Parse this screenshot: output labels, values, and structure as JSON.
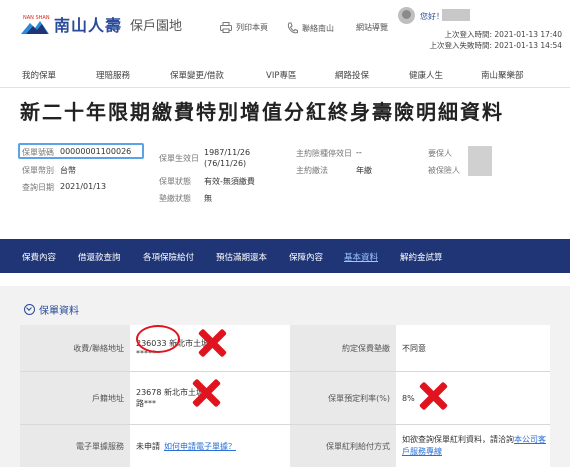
{
  "header": {
    "brand_name": "南山人壽",
    "portal_name": "保戶園地",
    "print_label": "列印本頁",
    "contact_label": "聯絡南山",
    "sitemap_label": "網站導覽",
    "greeting": "您好！",
    "last_login": "上次登入時間: 2021-01-13 17:40",
    "last_failed_login": "上次登入失敗時間: 2021-01-13 14:54"
  },
  "main_nav": [
    "我的保單",
    "理賠服務",
    "保單變更/借款",
    "VIP專區",
    "網路投保",
    "健康人生",
    "南山聚樂部"
  ],
  "page_title": "新二十年限期繳費特別增值分紅終身壽險明細資料",
  "summary": {
    "policy_no_label": "保單號碼",
    "policy_no": "00000001100026",
    "policy_type_label": "保單幣別",
    "policy_type": "台幣",
    "query_date_label": "查詢日期",
    "query_date": "2021/01/13",
    "effective_date_label": "保單生效日",
    "effective_date": "1987/11/26",
    "effective_date_alt": "(76/11/26)",
    "status_label": "保單狀態",
    "status": "有效-無須繳費",
    "loan_label": "墊繳狀態",
    "loan": "無",
    "rider_stop_label": "主約險種停效日",
    "rider_stop": "--",
    "pay_method_label": "主約繳法",
    "pay_method": "年繳",
    "insured_label": "要保人",
    "beneficiary_label": "被保險人"
  },
  "sub_nav": [
    "保費內容",
    "借還款查詢",
    "各項保險給付",
    "預估滿期還本",
    "保障內容",
    "基本資料",
    "解約金試算"
  ],
  "section_title": "保單資料",
  "table": {
    "row1": {
      "left_label": "收費/聯絡地址",
      "left_value_1": "236033 新北市土城區",
      "left_value_2": "*****",
      "right_label": "約定保費墊繳",
      "right_value": "不同意"
    },
    "row2": {
      "left_label": "戶籍地址",
      "left_value_1": "23678 新北市土城區",
      "left_value_2": "路***",
      "right_label": "保單預定利率(%)",
      "right_value": "8%"
    },
    "row3": {
      "left_label": "電子單據服務",
      "left_value_prefix": "未申請",
      "left_value_link": "如何申請電子單據？",
      "right_label": "保單紅利給付方式",
      "right_value_prefix": "如欲查詢保單紅利資料，請洽詢",
      "right_value_link": "本公司客戶服務專線"
    }
  },
  "colors": {
    "brand_blue": "#2a4a9a",
    "subnav_bg": "#1f3576",
    "annotation_red": "#e0141e",
    "highlight_blue": "#5aa3e8"
  }
}
